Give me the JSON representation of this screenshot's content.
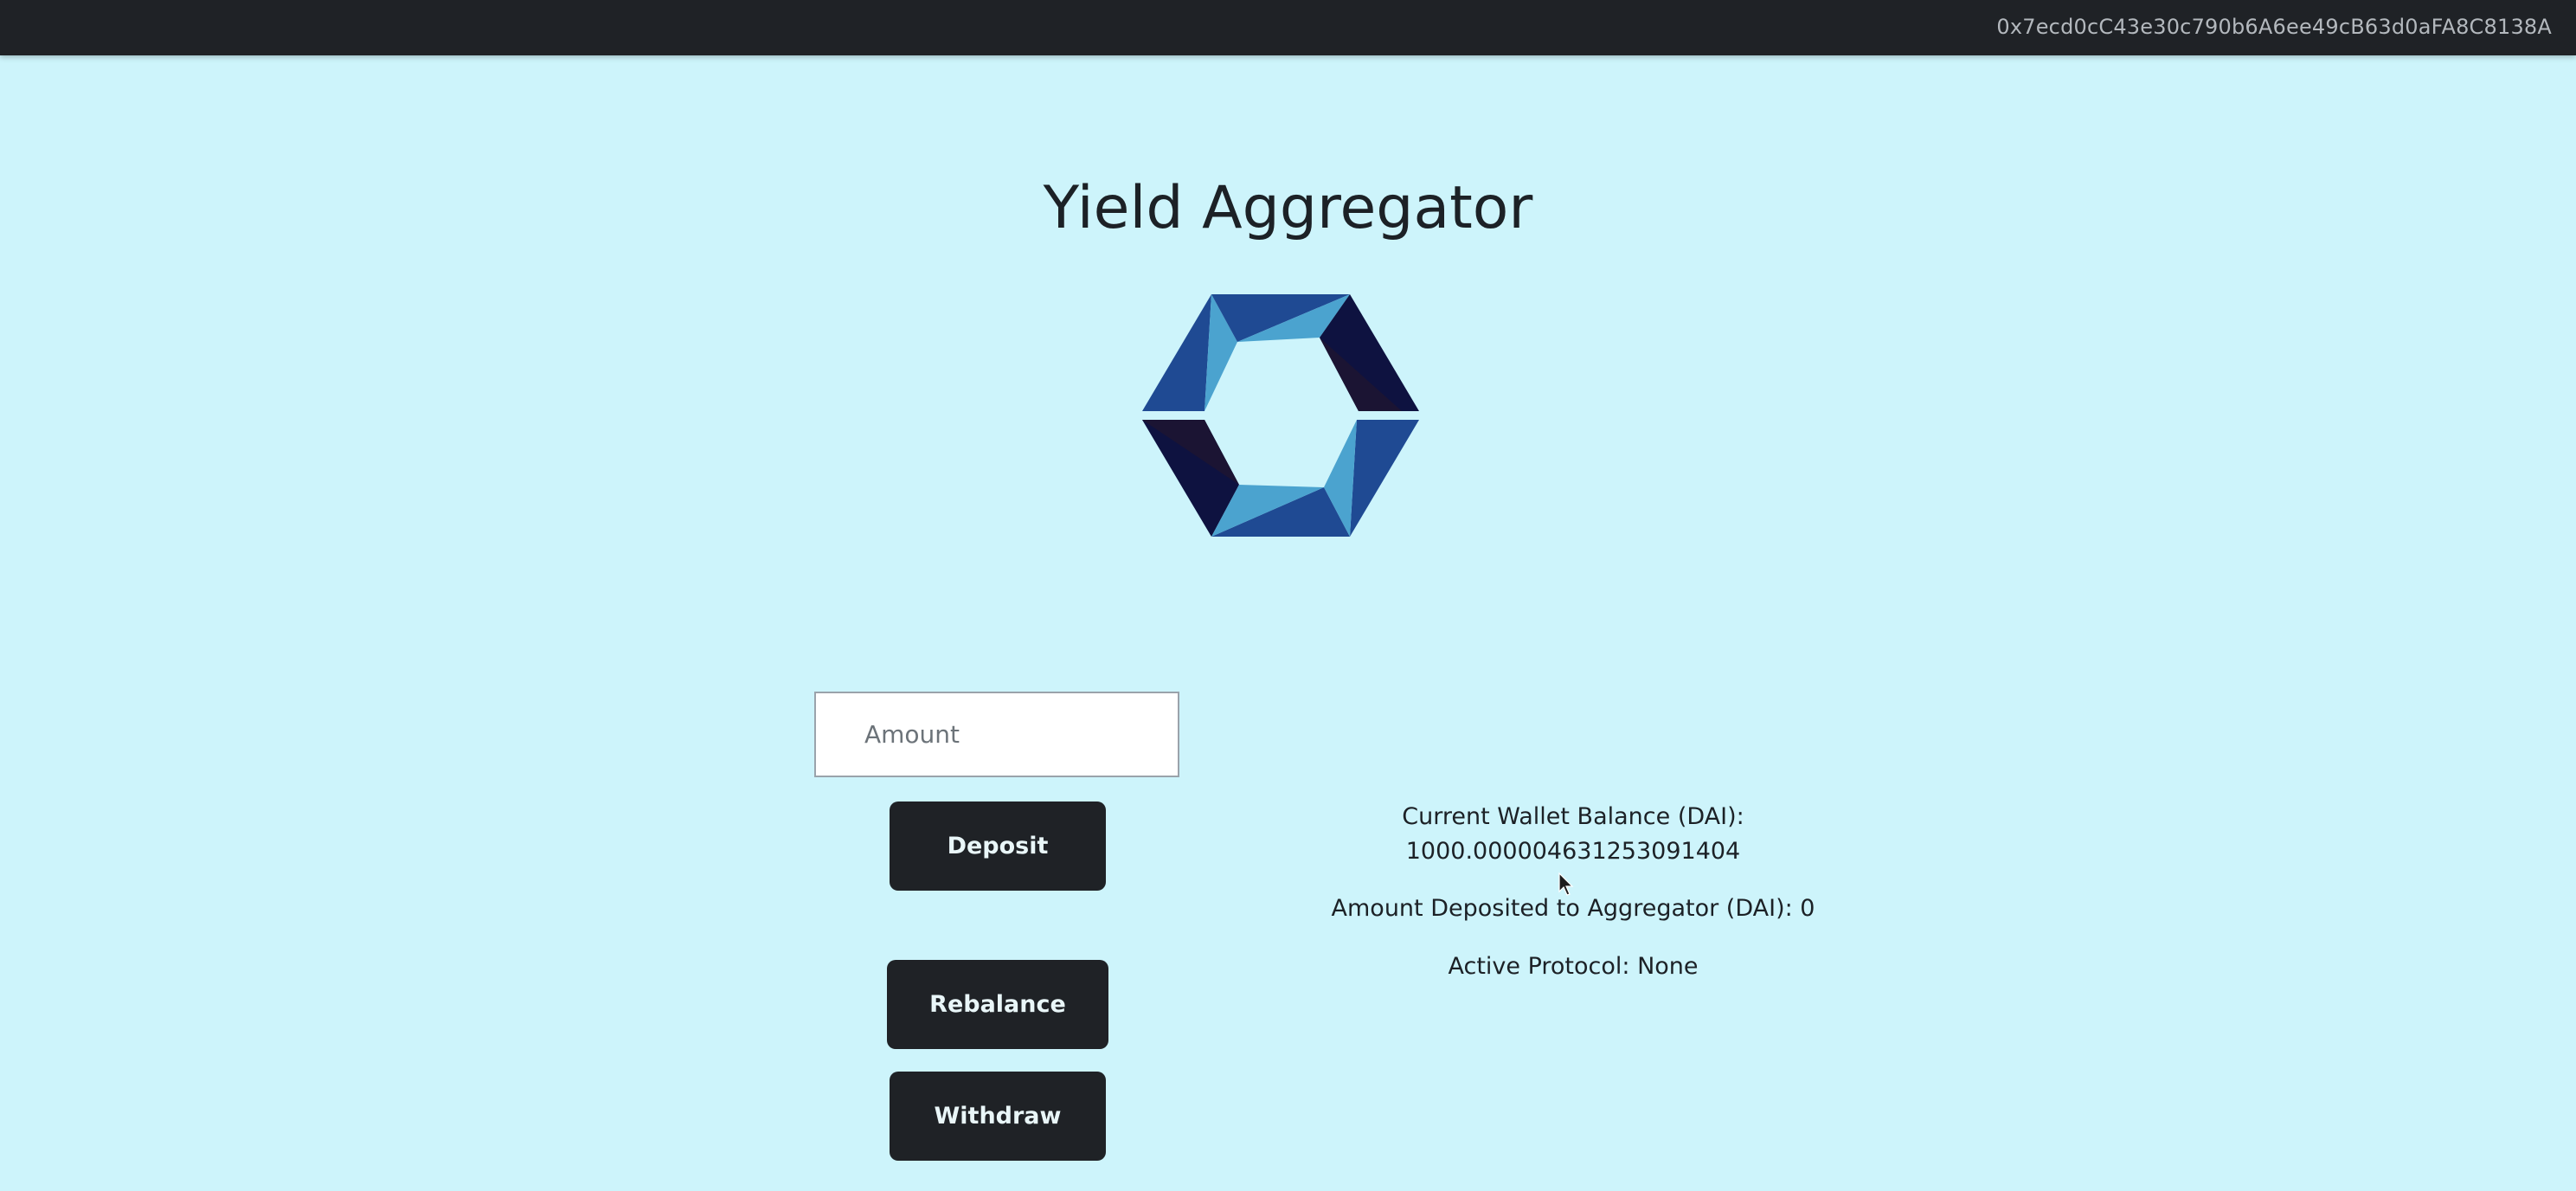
{
  "header": {
    "wallet_address": "0x7ecd0cC43e30c790b6A6ee49cB63d0aFA8C8138A"
  },
  "main": {
    "title": "Yield Aggregator",
    "amount_input": {
      "value": "",
      "placeholder": "Amount"
    },
    "buttons": {
      "deposit": "Deposit",
      "rebalance": "Rebalance",
      "withdraw": "Withdraw"
    },
    "info": {
      "balance_label": "Current Wallet Balance (DAI):",
      "balance_value": "1000.000004631253091404",
      "deposited": "Amount Deposited to Aggregator (DAI): 0",
      "protocol": "Active Protocol: None"
    }
  },
  "colors": {
    "background": "#cdf4fb",
    "topbar": "#1f2226",
    "button": "#1f2226",
    "logo_dark": "#0e1240",
    "logo_mid": "#1f4a93",
    "logo_light": "#4ba3cf"
  },
  "icons": {
    "logo": "hexagon-logo-icon",
    "cursor": "mouse-pointer-icon"
  }
}
